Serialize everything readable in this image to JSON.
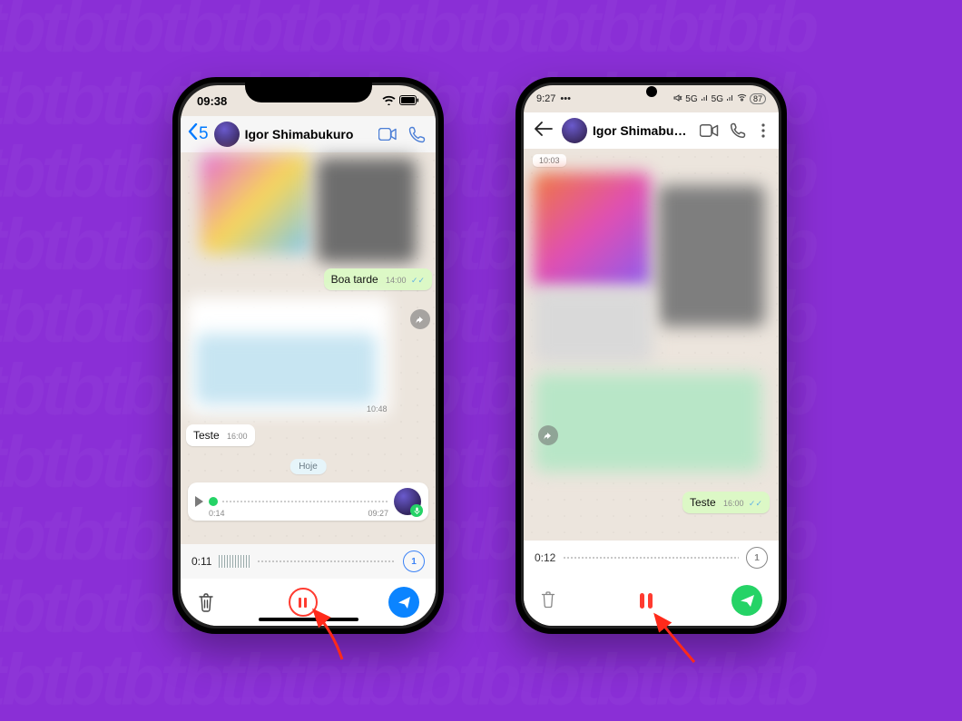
{
  "background_pattern_text": "tbtbtbtbtbtbtbtbtbtbtbtbtbtb",
  "iphone": {
    "status_time": "09:38",
    "back_count": "5",
    "contact_name": "Igor Shimabukuro",
    "msg_boa_tarde": "Boa tarde",
    "msg_boa_tarde_time": "14:00",
    "msg_teste": "Teste",
    "msg_teste_time": "16:00",
    "day_label": "Hoje",
    "voice_preview": {
      "elapsed": "0:14",
      "sent_time": "09:27"
    },
    "recording": {
      "elapsed": "0:11",
      "rate": "1"
    }
  },
  "android": {
    "status_time": "9:27",
    "status_network": "5G",
    "status_battery": "87",
    "contact_name": "Igor Shimabukuro",
    "timestamp_chip": "10:03",
    "msg_teste": "Teste",
    "msg_teste_time": "16:00",
    "recording": {
      "elapsed": "0:12",
      "rate": "1"
    }
  }
}
